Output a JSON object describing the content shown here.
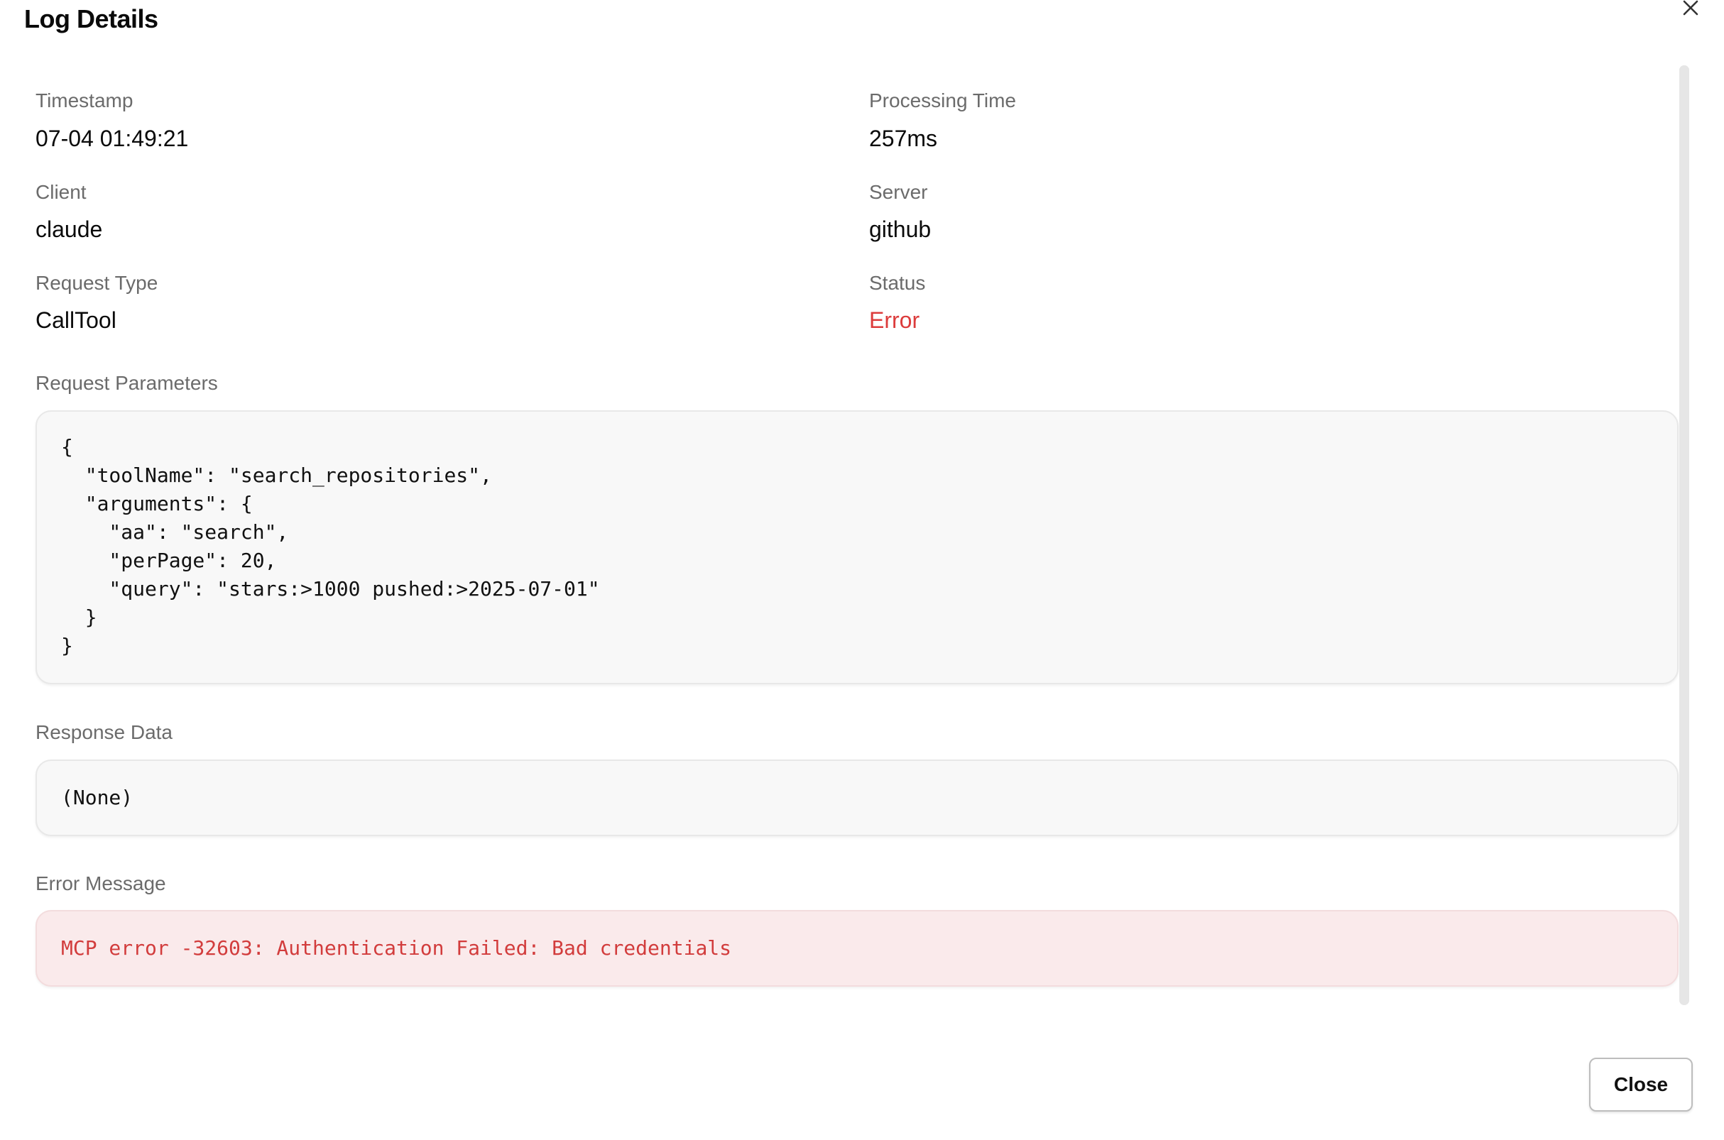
{
  "dialog": {
    "title": "Log Details",
    "close_icon": "close-icon",
    "close_button_label": "Close"
  },
  "fields": {
    "timestamp": {
      "label": "Timestamp",
      "value": "07-04 01:49:21"
    },
    "processing_time": {
      "label": "Processing Time",
      "value": "257ms"
    },
    "client": {
      "label": "Client",
      "value": "claude"
    },
    "server": {
      "label": "Server",
      "value": "github"
    },
    "request_type": {
      "label": "Request Type",
      "value": "CallTool"
    },
    "status": {
      "label": "Status",
      "value": "Error"
    }
  },
  "request_parameters": {
    "label": "Request Parameters",
    "content": "{\n  \"toolName\": \"search_repositories\",\n  \"arguments\": {\n    \"aa\": \"search\",\n    \"perPage\": 20,\n    \"query\": \"stars:>1000 pushed:>2025-07-01\"\n  }\n}"
  },
  "response_data": {
    "label": "Response Data",
    "content": "(None)"
  },
  "error_message": {
    "label": "Error Message",
    "content": "MCP error -32603: Authentication Failed: Bad credentials"
  },
  "colors": {
    "error_text": "#dc3c3c",
    "error_background": "#faeaeb",
    "code_background": "#f8f8f8",
    "label_gray": "#6b6b6b"
  }
}
